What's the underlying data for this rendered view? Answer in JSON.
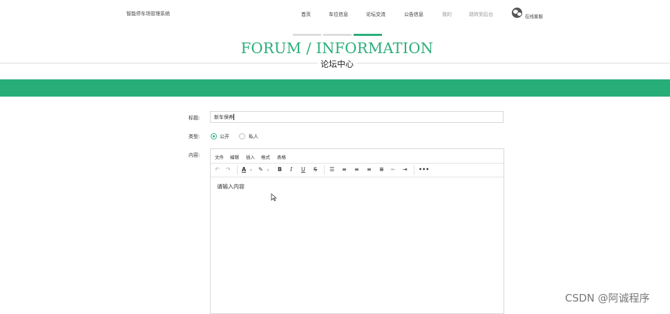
{
  "header": {
    "site_name": "智能停车场管理系统",
    "nav": [
      "首页",
      "车位信息",
      "论坛交流",
      "公告信息",
      "我的",
      "跳转到后台"
    ],
    "service_label": "在线客服"
  },
  "banner": {
    "title_en": "FORUM / INFORMATION",
    "title_cn": "论坛中心",
    "accent_color": "#27ae78"
  },
  "form": {
    "title_label": "标题:",
    "title_value": "新车保养",
    "type_label": "类型:",
    "type_options": [
      "公开",
      "私人"
    ],
    "type_selected": "公开",
    "content_label": "内容:",
    "editor": {
      "menus": [
        "文件",
        "编辑",
        "插入",
        "格式",
        "表格"
      ],
      "placeholder": "请输入内容"
    }
  },
  "watermark": "CSDN @阿诚程序"
}
